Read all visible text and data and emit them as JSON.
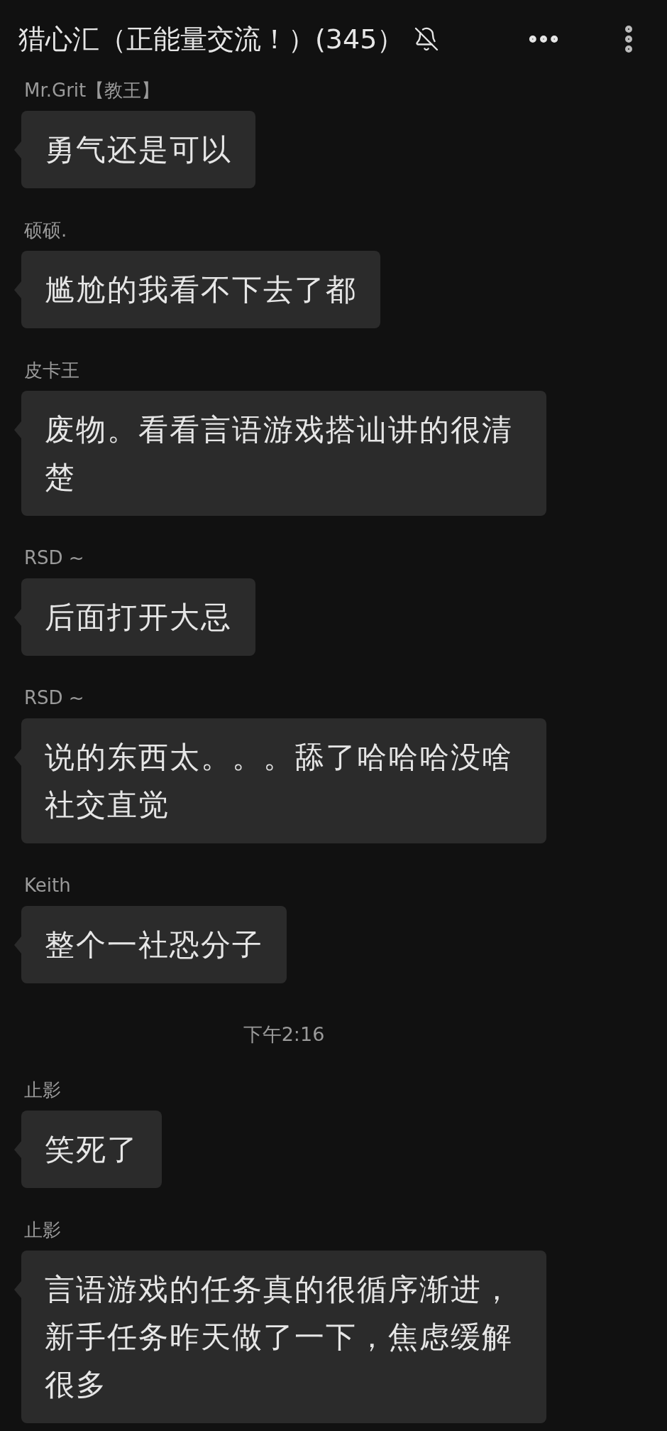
{
  "header": {
    "title": "猎心汇（正能量交流！）(345）",
    "muted": true
  },
  "messages": [
    {
      "kind": "message",
      "sender": "Mr.Grit【教王】",
      "text": "勇气还是可以"
    },
    {
      "kind": "message",
      "sender": "硕硕.",
      "text": "尴尬的我看不下去了都"
    },
    {
      "kind": "message",
      "sender": "皮卡王",
      "text": "废物。看看言语游戏搭讪讲的很清楚"
    },
    {
      "kind": "message",
      "sender": "RSD ~",
      "text": "后面打开大忌"
    },
    {
      "kind": "message",
      "sender": "RSD ~",
      "text": "说的东西太。。。舔了哈哈哈没啥社交直觉"
    },
    {
      "kind": "message",
      "sender": "Keith",
      "text": "整个一社恐分子"
    },
    {
      "kind": "time",
      "text": "下午2:16"
    },
    {
      "kind": "message",
      "sender": "止影",
      "text": "笑死了"
    },
    {
      "kind": "message",
      "sender": "止影",
      "text": "言语游戏的任务真的很循序渐进，新手任务昨天做了一下，焦虑缓解很多"
    }
  ]
}
